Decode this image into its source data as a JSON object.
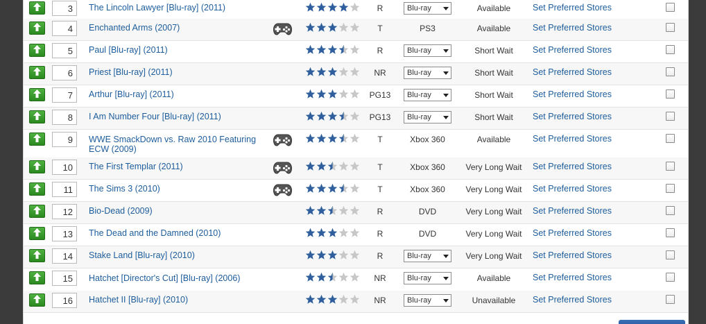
{
  "queue": {
    "store_link_label": "Set Preferred Stores",
    "items": [
      {
        "pos": "3",
        "title": "The Lincoln Lawyer [Blu-ray] (2011)",
        "game": false,
        "stars": 4,
        "rating": "R",
        "format": "Blu-ray",
        "format_type": "select",
        "availability": "Available"
      },
      {
        "pos": "4",
        "title": "Enchanted Arms (2007)",
        "game": true,
        "stars": 3,
        "rating": "T",
        "format": "PS3",
        "format_type": "text",
        "availability": "Available"
      },
      {
        "pos": "5",
        "title": "Paul [Blu-ray] (2011)",
        "game": false,
        "stars": 3.5,
        "rating": "R",
        "format": "Blu-ray",
        "format_type": "select",
        "availability": "Short Wait"
      },
      {
        "pos": "6",
        "title": "Priest [Blu-ray] (2011)",
        "game": false,
        "stars": 3,
        "rating": "NR",
        "format": "Blu-ray",
        "format_type": "select",
        "availability": "Short Wait"
      },
      {
        "pos": "7",
        "title": "Arthur [Blu-ray] (2011)",
        "game": false,
        "stars": 3,
        "rating": "PG13",
        "format": "Blu-ray",
        "format_type": "select",
        "availability": "Short Wait"
      },
      {
        "pos": "8",
        "title": "I Am Number Four [Blu-ray] (2011)",
        "game": false,
        "stars": 3.5,
        "rating": "PG13",
        "format": "Blu-ray",
        "format_type": "select",
        "availability": "Short Wait"
      },
      {
        "pos": "9",
        "title": "WWE SmackDown vs. Raw 2010 Featuring ECW (2009)",
        "game": true,
        "stars": 3.5,
        "rating": "T",
        "format": "Xbox 360",
        "format_type": "text",
        "availability": "Available"
      },
      {
        "pos": "10",
        "title": "The First Templar (2011)",
        "game": true,
        "stars": 2.5,
        "rating": "T",
        "format": "Xbox 360",
        "format_type": "text",
        "availability": "Very Long Wait"
      },
      {
        "pos": "11",
        "title": "The Sims 3 (2010)",
        "game": true,
        "stars": 3.5,
        "rating": "T",
        "format": "Xbox 360",
        "format_type": "text",
        "availability": "Very Long Wait"
      },
      {
        "pos": "12",
        "title": "Bio-Dead (2009)",
        "game": false,
        "stars": 2.5,
        "rating": "R",
        "format": "DVD",
        "format_type": "text",
        "availability": "Very Long Wait"
      },
      {
        "pos": "13",
        "title": "The Dead and the Damned (2010)",
        "game": false,
        "stars": 3,
        "rating": "R",
        "format": "DVD",
        "format_type": "text",
        "availability": "Very Long Wait"
      },
      {
        "pos": "14",
        "title": "Stake Land [Blu-ray] (2010)",
        "game": false,
        "stars": 3,
        "rating": "R",
        "format": "Blu-ray",
        "format_type": "select",
        "availability": "Very Long Wait"
      },
      {
        "pos": "15",
        "title": "Hatchet [Director's Cut] [Blu-ray] (2006)",
        "game": false,
        "stars": 2.5,
        "rating": "NR",
        "format": "Blu-ray",
        "format_type": "select",
        "availability": "Available"
      },
      {
        "pos": "16",
        "title": "Hatchet II [Blu-ray] (2010)",
        "game": false,
        "stars": 3,
        "rating": "NR",
        "format": "Blu-ray",
        "format_type": "select",
        "availability": "Unavailable"
      }
    ]
  },
  "colors": {
    "link": "#1d5d9c",
    "star": "#2f5f9e",
    "star_empty": "#c7c7c7",
    "move_button": "#3a9e2e"
  }
}
